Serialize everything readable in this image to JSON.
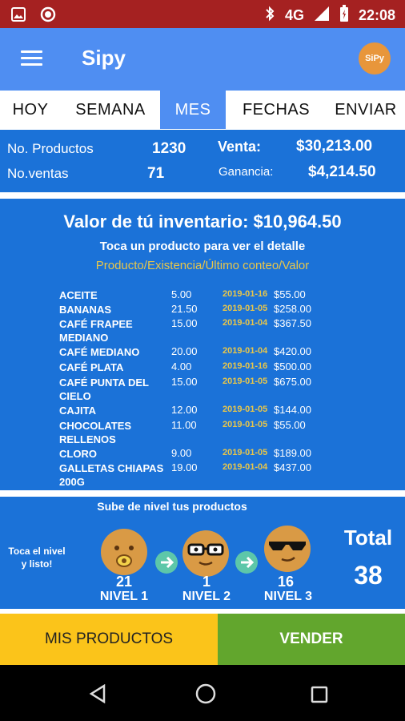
{
  "status_bar": {
    "network": "4G",
    "time": "22:08"
  },
  "app_bar": {
    "title": "Sipy",
    "logo_text": "SiPy"
  },
  "tabs": [
    {
      "label": "HOY"
    },
    {
      "label": "SEMANA"
    },
    {
      "label": "MES",
      "active": true
    },
    {
      "label": "FECHAS"
    },
    {
      "label": "ENVIAR"
    }
  ],
  "summary": {
    "products_label": "No. Productos",
    "products_value": "1230",
    "sales_label": "No.ventas",
    "sales_value": "71",
    "revenue_label": "Venta:",
    "revenue_value": "$30,213.00",
    "profit_label": "Ganancia:",
    "profit_value": "$4,214.50"
  },
  "inventory": {
    "title": "Valor de tú inventario: $10,964.50",
    "subtitle": "Toca un producto para ver el detalle",
    "columns": "Producto/Existencia/Último conteo/Valor",
    "items": [
      {
        "name": "ACEITE",
        "qty": "5.00",
        "date": "2019-01-16",
        "value": "$55.00"
      },
      {
        "name": "BANANAS",
        "qty": "21.50",
        "date": "2019-01-05",
        "value": "$258.00"
      },
      {
        "name": "CAFÉ FRAPEE MEDIANO",
        "qty": "15.00",
        "date": "2019-01-04",
        "value": "$367.50"
      },
      {
        "name": "CAFÉ MEDIANO",
        "qty": "20.00",
        "date": "2019-01-04",
        "value": "$420.00"
      },
      {
        "name": "CAFÉ PLATA",
        "qty": "4.00",
        "date": "2019-01-16",
        "value": "$500.00"
      },
      {
        "name": "CAFÉ PUNTA DEL CIELO",
        "qty": "15.00",
        "date": "2019-01-05",
        "value": "$675.00"
      },
      {
        "name": "CAJITA",
        "qty": "12.00",
        "date": "2019-01-05",
        "value": "$144.00"
      },
      {
        "name": "CHOCOLATES RELLENOS",
        "qty": "11.00",
        "date": "2019-01-05",
        "value": "$55.00"
      },
      {
        "name": "CLORO",
        "qty": "9.00",
        "date": "2019-01-05",
        "value": "$189.00"
      },
      {
        "name": "GALLETAS CHIAPAS 200G",
        "qty": "19.00",
        "date": "2019-01-04",
        "value": "$437.00"
      }
    ]
  },
  "levels": {
    "title": "Sube de nivel tus productos",
    "hint": "Toca el nivel y listo!",
    "items": [
      {
        "count": "21",
        "label": "NIVEL 1",
        "icon": "pacifier-face-icon"
      },
      {
        "count": "1",
        "label": "NIVEL 2",
        "icon": "glasses-face-icon"
      },
      {
        "count": "16",
        "label": "NIVEL 3",
        "icon": "sunglasses-face-icon"
      }
    ],
    "total_label": "Total",
    "total_value": "38"
  },
  "actions": {
    "my_products": "MIS PRODUCTOS",
    "sell": "VENDER"
  },
  "colors": {
    "status_bar": "#a52121",
    "app_bar": "#4f8ef2",
    "panel": "#1b72d8",
    "accent_yellow": "#fbc41a",
    "accent_green": "#62a62d",
    "date_text": "#e8c64a"
  }
}
